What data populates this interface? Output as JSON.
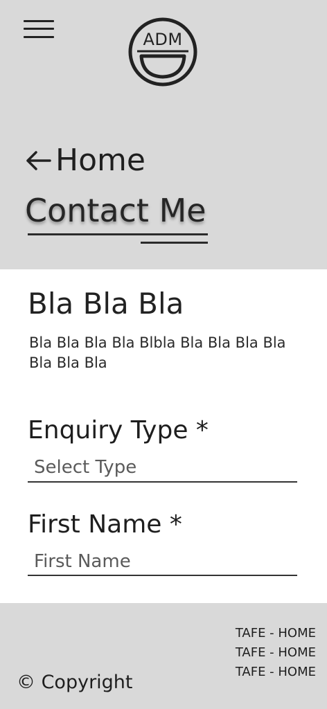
{
  "header": {
    "logo_text": "ADM",
    "back_label": "Home",
    "page_title": "Contact Me"
  },
  "content": {
    "heading": "Bla Bla Bla",
    "body": "Bla Bla Bla Bla Blbla Bla Bla Bla Bla Bla Bla Bla"
  },
  "form": {
    "enquiry": {
      "label": "Enquiry Type *",
      "selected": "Select Type"
    },
    "first_name": {
      "label": "First Name *",
      "placeholder": "First Name"
    }
  },
  "footer": {
    "links": [
      "TAFE - HOME",
      "TAFE - HOME",
      "TAFE - HOME"
    ],
    "copyright": "© Copyright"
  },
  "icons": {
    "menu": "hamburger-menu-icon",
    "back": "arrow-left-icon",
    "logo": "smiley-logo-icon"
  },
  "colors": {
    "header_bg": "#d9d9d9",
    "content_bg": "#ffffff",
    "text": "#1c1c1c"
  }
}
